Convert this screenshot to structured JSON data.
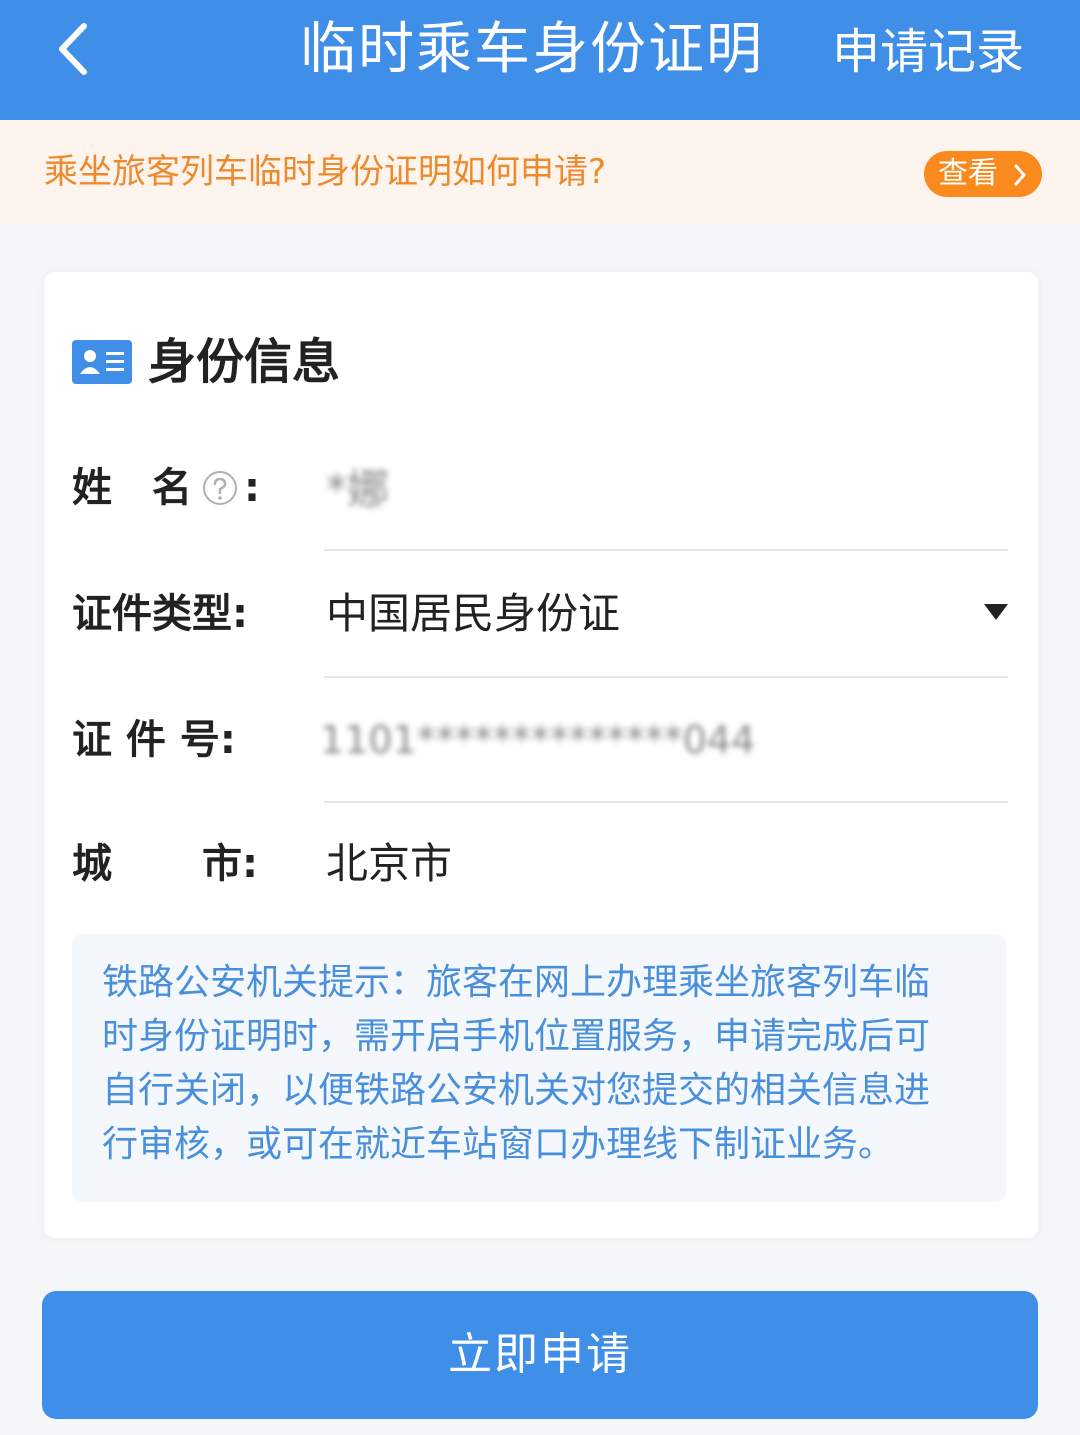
{
  "header": {
    "title": "临时乘车身份证明",
    "records_label": "申请记录"
  },
  "notice": {
    "text": "乘坐旅客列车临时身份证明如何申请?",
    "button_label": "查看"
  },
  "section": {
    "title": "身份信息"
  },
  "form": {
    "name_label": "姓　名",
    "name_value": "*娜",
    "id_type_label": "证件类型:",
    "id_type_value": "中国居民身份证",
    "id_no_label": "证 件 号:",
    "id_no_value": "1101**************044",
    "city_label_first": "城",
    "city_label_last": "市:",
    "city_value": "北京市"
  },
  "tip": {
    "lines": [
      "铁路公安机关提示：旅客在网上办理乘坐旅客列车临",
      "时身份证明时，需开启手机位置服务，申请完成后可",
      "自行关闭，以便铁路公安机关对您提交的相关信息进",
      "行审核，或可在就近车站窗口办理线下制证业务。"
    ]
  },
  "submit_label": "立即申请",
  "colors": {
    "primary": "#3f8fe8",
    "notice_bg": "#fdf4ed",
    "notice_text": "#ee8a2e",
    "notice_button": "#fa8a1e",
    "tip_text": "#4a8fdb"
  },
  "icons": {
    "back": "chevron-left-icon",
    "section": "id-card-icon",
    "help": "question-circle-icon",
    "dropdown": "caret-down-icon"
  }
}
